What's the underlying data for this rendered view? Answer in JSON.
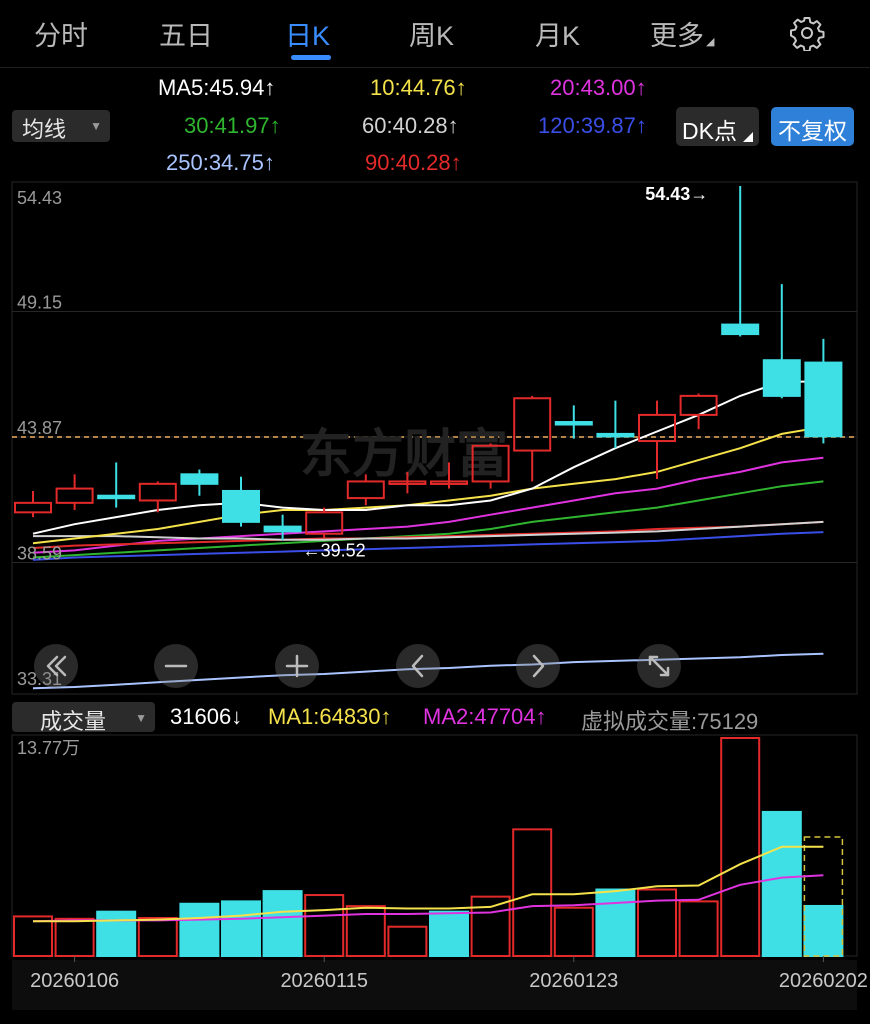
{
  "tabs": [
    {
      "label": "分时",
      "active": false
    },
    {
      "label": "五日",
      "active": false
    },
    {
      "label": "日K",
      "active": true
    },
    {
      "label": "周K",
      "active": false
    },
    {
      "label": "月K",
      "active": false
    },
    {
      "label": "更多",
      "active": false
    }
  ],
  "settings_icon": "gear-icon",
  "ma_selector": {
    "label": "均线"
  },
  "ma_values": [
    {
      "text": "MA5:45.94",
      "arrow": "↑",
      "color": "#ffffff"
    },
    {
      "text": "10:44.76",
      "arrow": "↑",
      "color": "#f5e24b"
    },
    {
      "text": "20:43.00",
      "arrow": "↑",
      "color": "#e033e0"
    },
    {
      "text": "30:41.97",
      "arrow": "↑",
      "color": "#2fb52f"
    },
    {
      "text": "60:40.28",
      "arrow": "↑",
      "color": "#d2d2d2"
    },
    {
      "text": "120:39.87",
      "arrow": "↑",
      "color": "#3a4ee8"
    },
    {
      "text": "250:34.75",
      "arrow": "↑",
      "color": "#a9c4ff"
    },
    {
      "text": "90:40.28",
      "arrow": "↑",
      "color": "#e32a2a"
    }
  ],
  "buttons": {
    "dk": "DK点",
    "fuquan": "不复权"
  },
  "volume_selector": {
    "label": "成交量"
  },
  "volume_legend": {
    "vol": "31606",
    "vol_arrow": "↓",
    "ma1": "MA1:64830",
    "ma1_arrow": "↑",
    "ma2": "MA2:47704",
    "ma2_arrow": "↑",
    "virtual": "虚拟成交量:75129"
  },
  "colors": {
    "up": "#e32a2a",
    "down": "#3ee0e6",
    "ma5": "#ffffff",
    "ma10": "#f5e24b",
    "ma20": "#e033e0",
    "ma30": "#2fb52f",
    "ma60": "#d2d2d2",
    "ma120": "#3a4ee8",
    "ma250": "#a9c4ff",
    "ma90": "#e32a2a",
    "accent": "#3a8dff",
    "current_price_line": "#f0b060"
  },
  "watermark": "东方财富",
  "nav_icons": [
    "double-chevron-left-icon",
    "zoom-out-icon",
    "zoom-in-icon",
    "chevron-left-icon",
    "chevron-right-icon",
    "fullscreen-icon"
  ],
  "chart_data": [
    {
      "type": "candlestick",
      "y_axis_labels": [
        "54.43",
        "49.15",
        "43.87",
        "38.59",
        "33.31"
      ],
      "ylim": [
        33.31,
        54.43
      ],
      "grid": true,
      "annotations": [
        {
          "text": "54.43→",
          "kind": "high"
        },
        {
          "text": "←39.52",
          "kind": "low"
        }
      ],
      "current_price": 43.87,
      "candles": [
        {
          "o": 40.7,
          "c": 41.1,
          "h": 41.6,
          "l": 40.5
        },
        {
          "o": 41.1,
          "c": 41.7,
          "h": 42.3,
          "l": 40.8
        },
        {
          "o": 41.4,
          "c": 41.3,
          "h": 42.8,
          "l": 40.9
        },
        {
          "o": 41.2,
          "c": 41.9,
          "h": 42.0,
          "l": 40.7
        },
        {
          "o": 42.3,
          "c": 41.9,
          "h": 42.5,
          "l": 41.4
        },
        {
          "o": 41.6,
          "c": 40.3,
          "h": 42.2,
          "l": 40.1
        },
        {
          "o": 40.1,
          "c": 39.9,
          "h": 40.6,
          "l": 39.52
        },
        {
          "o": 39.8,
          "c": 40.7,
          "h": 40.9,
          "l": 39.6
        },
        {
          "o": 41.3,
          "c": 42.0,
          "h": 42.3,
          "l": 41.0
        },
        {
          "o": 42.0,
          "c": 42.0,
          "h": 42.4,
          "l": 41.5
        },
        {
          "o": 42.0,
          "c": 42.0,
          "h": 42.8,
          "l": 41.7
        },
        {
          "o": 42.0,
          "c": 43.5,
          "h": 43.6,
          "l": 41.7
        },
        {
          "o": 43.3,
          "c": 45.5,
          "h": 45.6,
          "l": 42.0
        },
        {
          "o": 44.5,
          "c": 44.4,
          "h": 45.2,
          "l": 43.8
        },
        {
          "o": 44.0,
          "c": 43.9,
          "h": 45.4,
          "l": 43.4
        },
        {
          "o": 43.7,
          "c": 44.8,
          "h": 45.4,
          "l": 42.1
        },
        {
          "o": 44.8,
          "c": 45.6,
          "h": 45.7,
          "l": 44.2
        },
        {
          "o": 48.6,
          "c": 48.2,
          "h": 54.43,
          "l": 48.1
        },
        {
          "o": 47.1,
          "c": 45.6,
          "h": 50.3,
          "l": 45.5
        },
        {
          "o": 47.0,
          "c": 43.9,
          "h": 48.0,
          "l": 43.6
        }
      ],
      "ma_lines": {
        "ma5": [
          39.8,
          40.2,
          40.5,
          40.8,
          41.0,
          41.1,
          40.9,
          40.8,
          40.8,
          41.0,
          41.0,
          41.2,
          41.7,
          42.6,
          43.4,
          44.1,
          44.8,
          45.6,
          46.2,
          46.2
        ],
        "ma10": [
          39.4,
          39.6,
          39.8,
          40.0,
          40.3,
          40.6,
          40.8,
          40.8,
          40.9,
          41.0,
          41.2,
          41.4,
          41.7,
          41.9,
          42.1,
          42.4,
          42.9,
          43.4,
          44.0,
          44.3
        ],
        "ma20": [
          39.0,
          39.1,
          39.3,
          39.5,
          39.6,
          39.7,
          39.8,
          39.9,
          40.0,
          40.1,
          40.3,
          40.6,
          40.9,
          41.2,
          41.5,
          41.7,
          42.1,
          42.4,
          42.8,
          43.0
        ],
        "ma30": [
          38.8,
          38.9,
          39.0,
          39.1,
          39.2,
          39.3,
          39.4,
          39.5,
          39.6,
          39.7,
          39.8,
          40.0,
          40.3,
          40.5,
          40.7,
          40.9,
          41.2,
          41.5,
          41.8,
          42.0
        ],
        "ma60": [
          39.7,
          39.7,
          39.7,
          39.65,
          39.6,
          39.6,
          39.55,
          39.55,
          39.6,
          39.6,
          39.65,
          39.7,
          39.75,
          39.8,
          39.85,
          39.9,
          40.0,
          40.1,
          40.2,
          40.3
        ],
        "ma90": [
          39.2,
          39.3,
          39.35,
          39.4,
          39.45,
          39.5,
          39.55,
          39.6,
          39.6,
          39.65,
          39.7,
          39.75,
          39.8,
          39.85,
          39.9,
          40.0,
          40.05,
          40.1,
          40.2,
          40.3
        ],
        "ma120": [
          38.7,
          38.8,
          38.85,
          38.9,
          38.95,
          39.0,
          39.05,
          39.1,
          39.15,
          39.2,
          39.25,
          39.3,
          39.35,
          39.4,
          39.45,
          39.5,
          39.6,
          39.7,
          39.8,
          39.87
        ],
        "ma250": [
          33.3,
          33.35,
          33.45,
          33.55,
          33.65,
          33.75,
          33.85,
          33.9,
          34.0,
          34.1,
          34.15,
          34.25,
          34.3,
          34.4,
          34.45,
          34.5,
          34.55,
          34.6,
          34.7,
          34.75
        ]
      }
    },
    {
      "type": "bar",
      "ylabel": "13.77万",
      "ylim": [
        0,
        137700
      ],
      "x_tick_labels": [
        "20260106",
        "20260115",
        "20260123",
        "20260202"
      ],
      "volumes": [
        {
          "v": 25000,
          "up": true
        },
        {
          "v": 23500,
          "up": true
        },
        {
          "v": 28000,
          "up": false
        },
        {
          "v": 24000,
          "up": true
        },
        {
          "v": 33000,
          "up": false
        },
        {
          "v": 34500,
          "up": false
        },
        {
          "v": 41000,
          "up": false
        },
        {
          "v": 38500,
          "up": true
        },
        {
          "v": 31500,
          "up": true
        },
        {
          "v": 18500,
          "up": true
        },
        {
          "v": 28000,
          "up": false
        },
        {
          "v": 37500,
          "up": true
        },
        {
          "v": 80000,
          "up": true
        },
        {
          "v": 30500,
          "up": true
        },
        {
          "v": 42000,
          "up": false
        },
        {
          "v": 42000,
          "up": true
        },
        {
          "v": 34500,
          "up": true
        },
        {
          "v": 137700,
          "up": true
        },
        {
          "v": 91000,
          "up": false
        },
        {
          "v": 31606,
          "up": false
        }
      ],
      "virtual_volume": 75129,
      "ma1": [
        22000,
        22000,
        22500,
        23000,
        24000,
        25500,
        28000,
        29000,
        30500,
        30000,
        30000,
        31000,
        39000,
        39000,
        41000,
        44000,
        44500,
        58000,
        69000,
        69000
      ],
      "ma2": [
        22000,
        22500,
        22500,
        22500,
        23000,
        23500,
        24500,
        25500,
        26500,
        26500,
        27000,
        27500,
        31500,
        32000,
        33500,
        35000,
        35500,
        45000,
        49500,
        51000
      ]
    }
  ]
}
